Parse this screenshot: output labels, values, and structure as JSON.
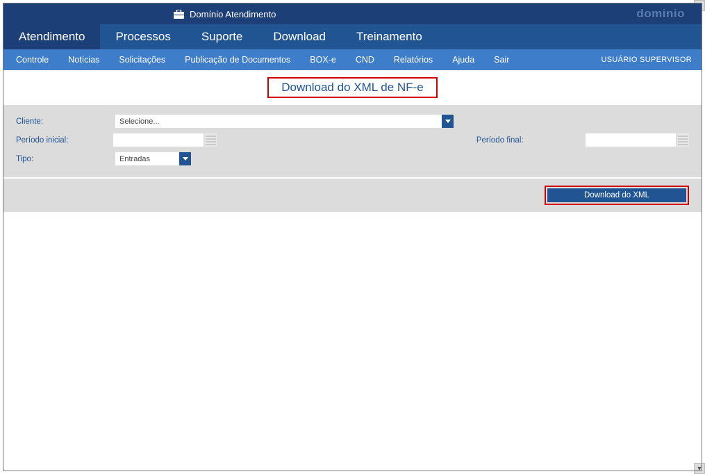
{
  "titlebar": {
    "app_name": "Domínio Atendimento",
    "brand": "dominio"
  },
  "main_tabs": [
    "Atendimento",
    "Processos",
    "Suporte",
    "Download",
    "Treinamento"
  ],
  "active_main_tab_index": 0,
  "sub_menu": [
    "Controle",
    "Notícias",
    "Solicitações",
    "Publicação de Documentos",
    "BOX-e",
    "CND",
    "Relatórios",
    "Ajuda",
    "Sair"
  ],
  "user_label": "USUÁRIO SUPERVISOR",
  "page_title": "Download do XML de NF-e",
  "form": {
    "cliente_label": "Cliente:",
    "cliente_value": "Selecione...",
    "periodo_inicial_label": "Período inicial:",
    "periodo_inicial_value": "",
    "periodo_final_label": "Período final:",
    "periodo_final_value": "",
    "tipo_label": "Tipo:",
    "tipo_value": "Entradas"
  },
  "download_button": "Download do XML"
}
